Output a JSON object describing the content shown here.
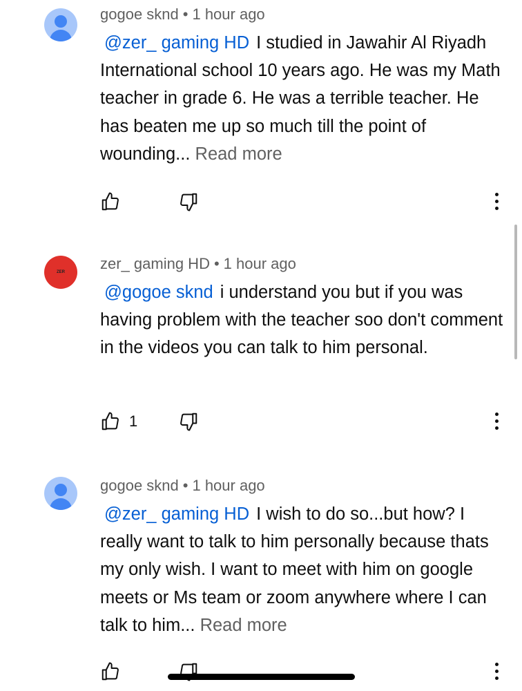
{
  "comments": [
    {
      "author": "gogoe sknd",
      "time": "1 hour ago",
      "mention": "@zer_ gaming HD",
      "text": "I studied in Jawahir Al Riyadh International school 10 years ago. He was my Math teacher in grade 6. He was a terrible teacher. He has beaten me up so much till the point of wounding...",
      "read_more": "Read more",
      "like_count": "",
      "avatar": "default-person-avatar"
    },
    {
      "author": "zer_ gaming HD",
      "time": "1 hour ago",
      "mention": "@gogoe sknd",
      "text": "i understand you but if you was having problem with the teacher soo don't comment in the videos you can talk to him personal.",
      "read_more": "",
      "like_count": "1",
      "avatar": "red-channel-avatar",
      "avatar_text": "ZER"
    },
    {
      "author": "gogoe sknd",
      "time": "1 hour ago",
      "mention": "@zer_ gaming HD",
      "text": "I wish to do so...but how? I really want to talk to him personally because thats my only wish. I want to meet with him on google meets or Ms team or zoom anywhere where I can talk to him...",
      "read_more": "Read more",
      "like_count": "",
      "avatar": "default-person-avatar"
    }
  ],
  "separator": "•",
  "icons": {
    "like": "thumbs-up-icon",
    "dislike": "thumbs-down-icon",
    "more": "more-vertical-icon"
  },
  "colors": {
    "mention": "#065fd4",
    "meta": "#606060",
    "red_avatar": "#e0302a",
    "default_avatar_bg": "#a8c7fa",
    "default_avatar_fg": "#4285f4"
  }
}
